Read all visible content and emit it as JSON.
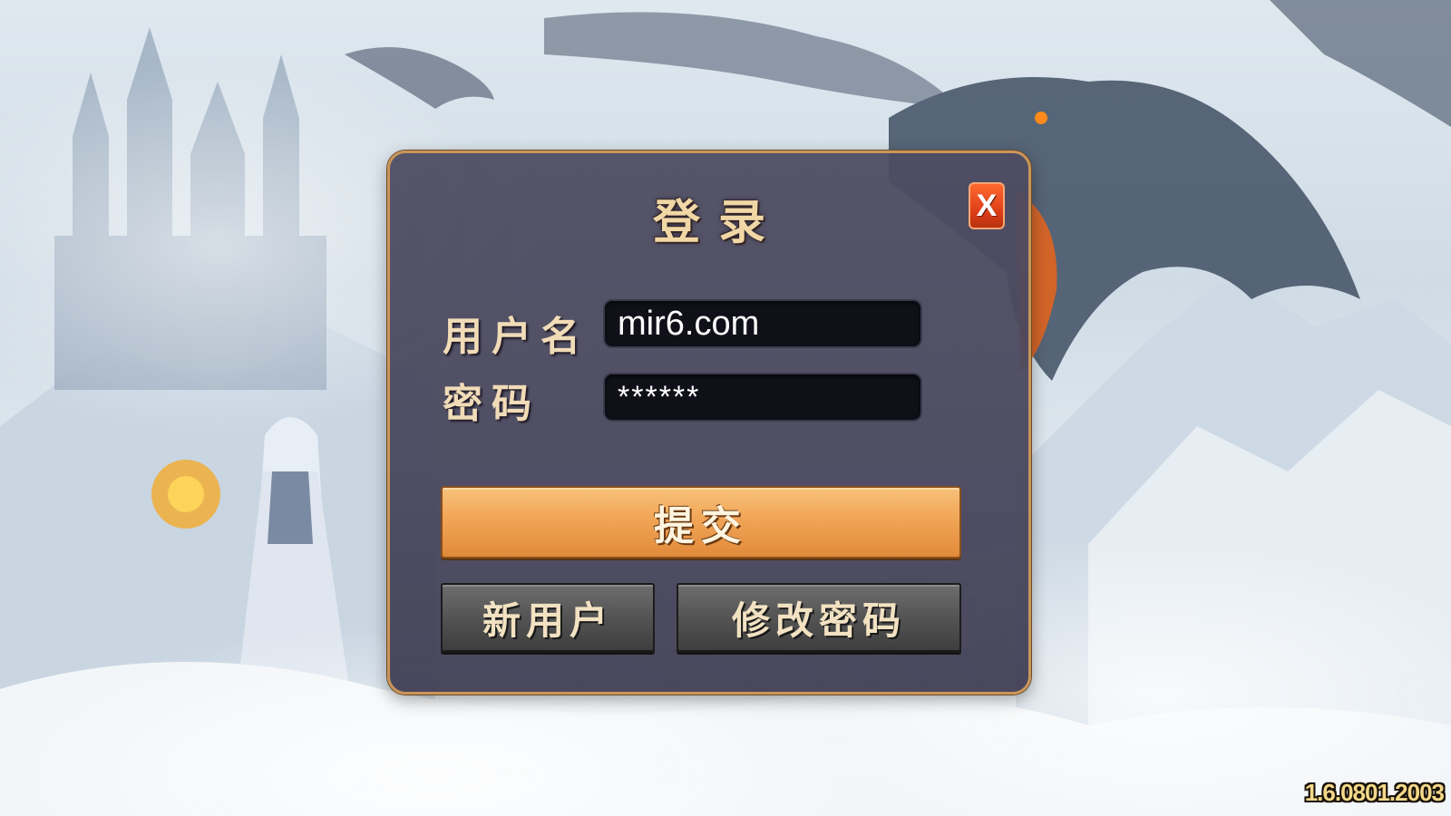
{
  "dialog": {
    "title": "登录",
    "close_label": "X",
    "username_label": "用户名",
    "username_value": "mir6.com",
    "password_label": "密码",
    "password_value": "******",
    "submit_label": "提交",
    "new_user_label": "新用户",
    "change_password_label": "修改密码"
  },
  "footer": {
    "version": "1.6.0801.2003"
  },
  "colors": {
    "dialog_border": "#c9955a",
    "dialog_bg": "#4e4c62",
    "submit_button": "#f1a556",
    "close_button": "#e0401a",
    "version_text": "#f4d98a"
  }
}
